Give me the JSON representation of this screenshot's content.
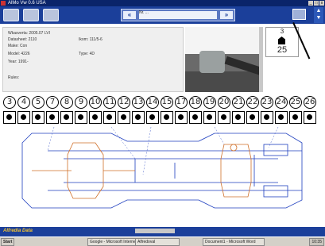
{
  "window": {
    "title": "AlMo Vw 0.6 USA",
    "controls": [
      "_",
      "□",
      "x"
    ]
  },
  "toolbar": {
    "nav_field_text": "Nr. ...",
    "prev_label": "«",
    "next_label": "»"
  },
  "info": {
    "line1": "Wkasverta: 2005.07 LVI",
    "line2": "Datasheet: 2110",
    "line2b": "Ikom: 111/5-6",
    "line3": "Make: Con",
    "line4": "Model: 4226",
    "line4b": "Type: 4D",
    "line5": "Year: 1991-",
    "line6": "Rules:"
  },
  "counter": {
    "top": "3",
    "bottom": "25"
  },
  "numbers": [
    "3",
    "4",
    "5",
    "7",
    "8",
    "9",
    "10",
    "11",
    "12",
    "13",
    "14",
    "15",
    "17",
    "18",
    "19",
    "20",
    "21",
    "22",
    "23",
    "24",
    "25",
    "26"
  ],
  "statusbar": {
    "brand": "Alfredia Data"
  },
  "taskbar": {
    "start": "Start",
    "items": [
      "Google - Microsoft Internet...",
      "Alfredoval",
      "Document1 - Microsoft Word"
    ],
    "tray": "10:35"
  }
}
